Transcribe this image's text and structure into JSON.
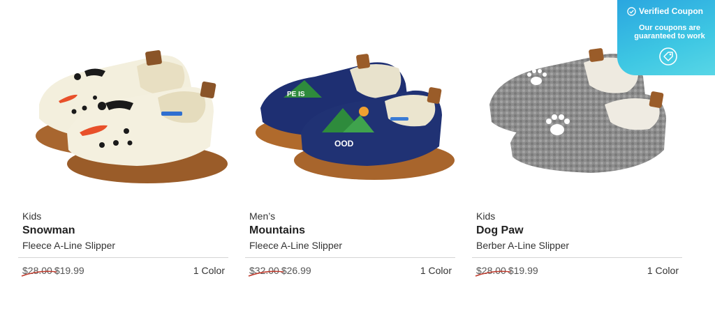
{
  "products": [
    {
      "category": "Kids",
      "name": "Snowman",
      "style": "Fleece A-Line Slipper",
      "old_price": "$28.00",
      "new_price": "$19.99",
      "colors": "1 Color",
      "image_icon": "snowman-slipper-image"
    },
    {
      "category": "Men’s",
      "name": "Mountains",
      "style": "Fleece A-Line Slipper",
      "old_price": "$32.00",
      "new_price": "$26.99",
      "colors": "1 Color",
      "image_icon": "mountains-slipper-image"
    },
    {
      "category": "Kids",
      "name": "Dog Paw",
      "style": "Berber A-Line Slipper",
      "old_price": "$28.00",
      "new_price": "$19.99",
      "colors": "1 Color",
      "image_icon": "dog-paw-slipper-image"
    }
  ],
  "coupon": {
    "title": "Verified Coupon",
    "subtitle": "Our coupons are guaranteed to work",
    "icon": "coupon-tag-icon",
    "check_icon": "check-circle-icon"
  },
  "colors": {
    "strike": "#c0392b",
    "coupon_start": "#2aa6e0",
    "coupon_end": "#58d6e6",
    "divider": "#d5d5d5"
  }
}
